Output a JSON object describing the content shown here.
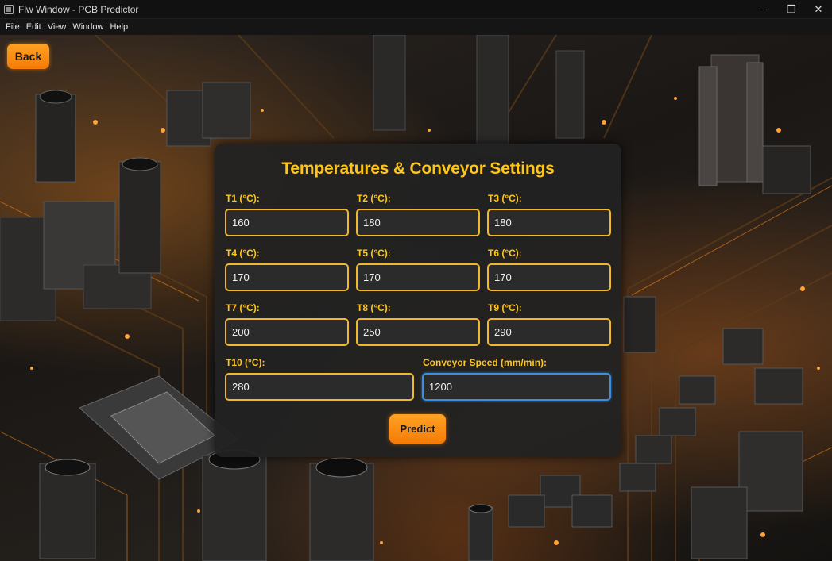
{
  "window": {
    "title": "Flw Window - PCB Predictor",
    "minimize_glyph": "–",
    "maximize_glyph": "❐",
    "close_glyph": "✕"
  },
  "menu": [
    "File",
    "Edit",
    "View",
    "Window",
    "Help"
  ],
  "back_button": "Back",
  "form": {
    "title": "Temperatures & Conveyor Settings",
    "fields": [
      {
        "label": "T1 (°C):",
        "value": "160"
      },
      {
        "label": "T2 (°C):",
        "value": "180"
      },
      {
        "label": "T3 (°C):",
        "value": "180"
      },
      {
        "label": "T4 (°C):",
        "value": "170"
      },
      {
        "label": "T5 (°C):",
        "value": "170"
      },
      {
        "label": "T6 (°C):",
        "value": "170"
      },
      {
        "label": "T7 (°C):",
        "value": "200"
      },
      {
        "label": "T8 (°C):",
        "value": "250"
      },
      {
        "label": "T9 (°C):",
        "value": "290"
      },
      {
        "label": "T10 (°C):",
        "value": "280"
      },
      {
        "label": "Conveyor Speed (mm/min):",
        "value": "1200"
      }
    ],
    "predict_button": "Predict"
  },
  "colors": {
    "accent": "#ffc61a",
    "button": "#f57b07",
    "focus": "#3a8fe0"
  }
}
